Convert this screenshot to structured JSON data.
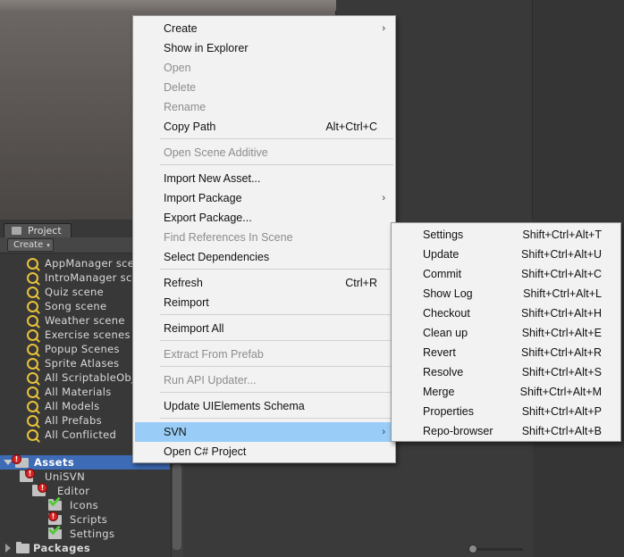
{
  "project_panel": {
    "tab_label": "Project",
    "create_label": "Create",
    "create_arrow": "▾",
    "favorites": [
      "AppManager scene",
      "IntroManager scene",
      "Quiz scene",
      "Song scene",
      "Weather scene",
      "Exercise scenes",
      "Popup Scenes",
      "Sprite Atlases",
      "All ScriptableObjects",
      "All Materials",
      "All Models",
      "All Prefabs",
      "All Conflicted"
    ],
    "tree": {
      "assets": "Assets",
      "unisvn": "UniSVN",
      "editor": "Editor",
      "icons": "Icons",
      "scripts": "Scripts",
      "settings": "Settings",
      "packages": "Packages"
    }
  },
  "context_menu": {
    "create": "Create",
    "show_in_explorer": "Show in Explorer",
    "open": "Open",
    "delete": "Delete",
    "rename": "Rename",
    "copy_path": "Copy Path",
    "copy_path_shortcut": "Alt+Ctrl+C",
    "open_scene_additive": "Open Scene Additive",
    "import_new_asset": "Import New Asset...",
    "import_package": "Import Package",
    "export_package": "Export Package...",
    "find_references": "Find References In Scene",
    "select_dependencies": "Select Dependencies",
    "refresh": "Refresh",
    "refresh_shortcut": "Ctrl+R",
    "reimport": "Reimport",
    "reimport_all": "Reimport All",
    "extract_from_prefab": "Extract From Prefab",
    "run_api_updater": "Run API Updater...",
    "update_uielements": "Update UIElements Schema",
    "svn": "SVN",
    "open_csharp_project": "Open C# Project",
    "submenu_arrow": "›"
  },
  "svn_submenu": [
    {
      "label": "Settings",
      "shortcut": "Shift+Ctrl+Alt+T"
    },
    {
      "label": "Update",
      "shortcut": "Shift+Ctrl+Alt+U"
    },
    {
      "label": "Commit",
      "shortcut": "Shift+Ctrl+Alt+C"
    },
    {
      "label": "Show Log",
      "shortcut": "Shift+Ctrl+Alt+L"
    },
    {
      "label": "Checkout",
      "shortcut": "Shift+Ctrl+Alt+H"
    },
    {
      "label": "Clean up",
      "shortcut": "Shift+Ctrl+Alt+E"
    },
    {
      "label": "Revert",
      "shortcut": "Shift+Ctrl+Alt+R"
    },
    {
      "label": "Resolve",
      "shortcut": "Shift+Ctrl+Alt+S"
    },
    {
      "label": "Merge",
      "shortcut": "Shift+Ctrl+Alt+M"
    },
    {
      "label": "Properties",
      "shortcut": "Shift+Ctrl+Alt+P"
    },
    {
      "label": "Repo-browser",
      "shortcut": "Shift+Ctrl+Alt+B"
    }
  ],
  "colors": {
    "highlight": "#99ccf6",
    "selection": "#3d6bb5",
    "search_icon": "#e8c23a",
    "conflict_icon": "#d62222",
    "ok_icon": "#56c83a"
  }
}
